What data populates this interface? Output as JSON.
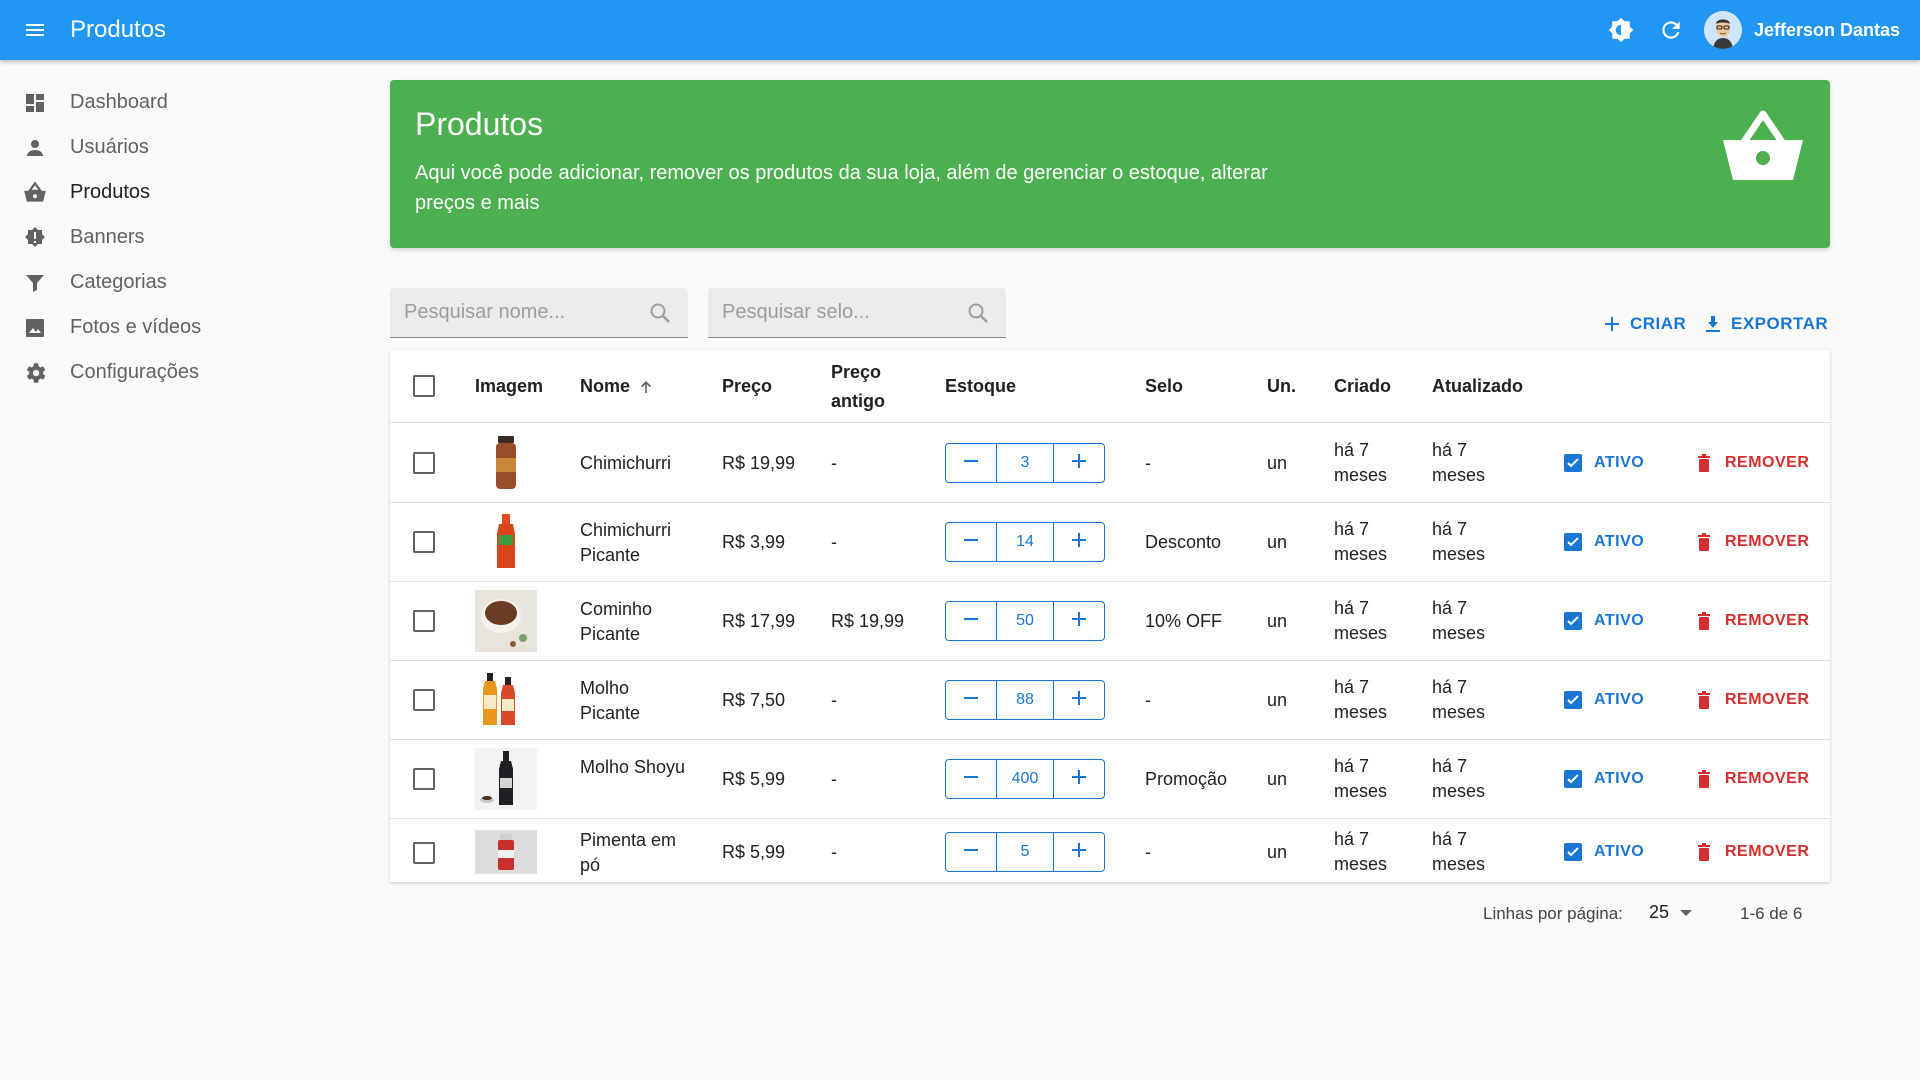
{
  "appbar": {
    "title": "Produtos",
    "user_name": "Jefferson Dantas"
  },
  "sidebar": {
    "items": [
      {
        "label": "Dashboard",
        "icon": "dashboard-icon"
      },
      {
        "label": "Usuários",
        "icon": "person-icon"
      },
      {
        "label": "Produtos",
        "icon": "basket-icon"
      },
      {
        "label": "Banners",
        "icon": "alert-badge-icon"
      },
      {
        "label": "Categorias",
        "icon": "filter-icon"
      },
      {
        "label": "Fotos e vídeos",
        "icon": "image-icon"
      },
      {
        "label": "Configurações",
        "icon": "gear-icon"
      }
    ]
  },
  "banner": {
    "title": "Produtos",
    "description": "Aqui você pode adicionar, remover os produtos da sua loja, além de gerenciar o estoque, alterar preços e mais",
    "color": "#4caf50"
  },
  "search": {
    "name_placeholder": "Pesquisar nome...",
    "seal_placeholder": "Pesquisar selo..."
  },
  "actions": {
    "create_label": "CRIAR",
    "export_label": "EXPORTAR"
  },
  "table": {
    "headers": {
      "image": "Imagem",
      "name": "Nome",
      "price": "Preço",
      "old_price": "Preço antigo",
      "stock": "Estoque",
      "seal": "Selo",
      "unit": "Un.",
      "created": "Criado",
      "updated": "Atualizado"
    },
    "rows": [
      {
        "name": "Chimichurri",
        "price": "R$ 19,99",
        "old_price": "-",
        "stock": "3",
        "seal": "-",
        "unit": "un",
        "created": "há 7 meses",
        "updated": "há 7 meses",
        "status": "ATIVO",
        "remove": "REMOVER"
      },
      {
        "name": "Chimichurri Picante",
        "price": "R$ 3,99",
        "old_price": "-",
        "stock": "14",
        "seal": "Desconto",
        "unit": "un",
        "created": "há 7 meses",
        "updated": "há 7 meses",
        "status": "ATIVO",
        "remove": "REMOVER"
      },
      {
        "name": "Cominho Picante",
        "price": "R$ 17,99",
        "old_price": "R$ 19,99",
        "stock": "50",
        "seal": "10% OFF",
        "unit": "un",
        "created": "há 7 meses",
        "updated": "há 7 meses",
        "status": "ATIVO",
        "remove": "REMOVER"
      },
      {
        "name": "Molho Picante",
        "price": "R$ 7,50",
        "old_price": "-",
        "stock": "88",
        "seal": "-",
        "unit": "un",
        "created": "há 7 meses",
        "updated": "há 7 meses",
        "status": "ATIVO",
        "remove": "REMOVER"
      },
      {
        "name": "Molho Shoyu",
        "price": "R$ 5,99",
        "old_price": "-",
        "stock": "400",
        "seal": "Promoção",
        "unit": "un",
        "created": "há 7 meses",
        "updated": "há 7 meses",
        "status": "ATIVO",
        "remove": "REMOVER"
      },
      {
        "name": "Pimenta em pó",
        "price": "R$ 5,99",
        "old_price": "-",
        "stock": "5",
        "seal": "-",
        "unit": "un",
        "created": "há 7 meses",
        "updated": "há 7 meses",
        "status": "ATIVO",
        "remove": "REMOVER"
      }
    ]
  },
  "pagination": {
    "rows_label": "Linhas por página:",
    "rows_per_page": "25",
    "range": "1-6 de 6"
  },
  "colors": {
    "primary": "#2196f3",
    "accent": "#1976d2",
    "danger": "#d32f2f",
    "banner": "#4caf50"
  }
}
